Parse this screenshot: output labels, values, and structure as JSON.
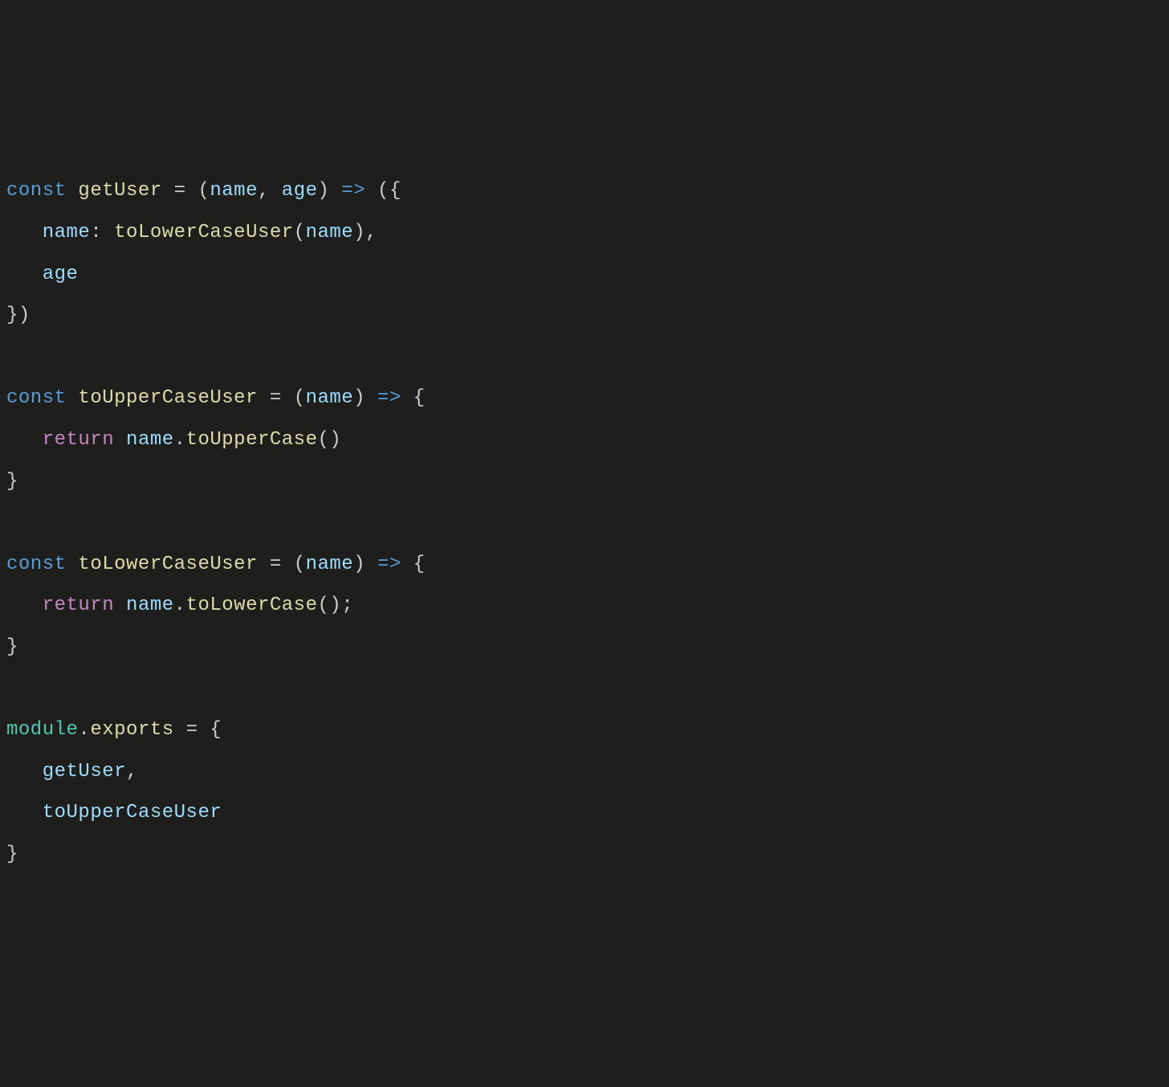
{
  "tokens": {
    "kw_const": "const",
    "kw_return": "return",
    "fn_getUser": "getUser",
    "fn_toUpperCaseUser": "toUpperCaseUser",
    "fn_toLowerCaseUser": "toLowerCaseUser",
    "param_name": "name",
    "param_age": "age",
    "prop_name": "name",
    "prop_age": "age",
    "method_toUpperCase": "toUpperCase",
    "method_toLowerCase": "toLowerCase",
    "obj_module": "module",
    "prop_exports": "exports",
    "arrow": "=>",
    "eq": "=",
    "colon": ":",
    "comma": ",",
    "semicolon": ";",
    "dot": ".",
    "lparen": "(",
    "rparen": ")",
    "lbrace": "{",
    "rbrace": "}",
    "lparen_brace": "({",
    "rbrace_paren": "})",
    "parens": "()"
  },
  "colors": {
    "background": "#1e1f1c",
    "keyword": "#569cd6",
    "function": "#dcdcaa",
    "param": "#9cdcfe",
    "return": "#c586c0",
    "property": "#4ec9b0",
    "punct": "#cccccc"
  }
}
